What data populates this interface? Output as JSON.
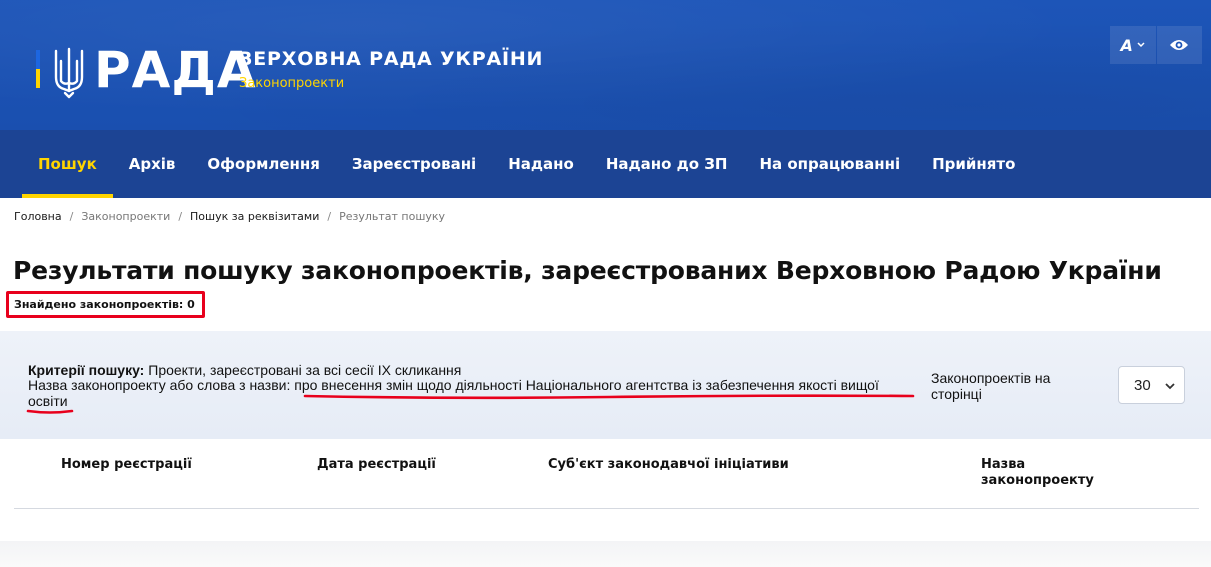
{
  "header": {
    "logo_word": "РАДА",
    "org_title": "ВЕРХОВНА РАДА УКРАЇНИ",
    "org_subtitle": "Законопроекти",
    "font_size_button": "A",
    "colors": {
      "header_bg": "#1d55b8",
      "nav_bg": "#1c4494",
      "accent": "#ffd500",
      "flag_blue": "#1d66e0",
      "flag_yellow": "#ffd500"
    }
  },
  "nav": {
    "items": [
      {
        "label": "Пошук",
        "active": true
      },
      {
        "label": "Архів"
      },
      {
        "label": "Оформлення"
      },
      {
        "label": "Зареєстровані"
      },
      {
        "label": "Надано"
      },
      {
        "label": "Надано до ЗП"
      },
      {
        "label": "На опрацюванні"
      },
      {
        "label": "Прийнято"
      }
    ]
  },
  "breadcrumb": {
    "items": [
      "Головна",
      "Законопроекти",
      "Пошук за реквізитами",
      "Результат пошуку"
    ]
  },
  "main": {
    "title": "Результати пошуку законопроектів, зареєстрованих Верховною Радою України",
    "found_label": "Знайдено законопроектів: 0"
  },
  "criteria": {
    "label": "Критерії пошуку:",
    "value": "Проекти, зареєстровані за всі сесії IX скликання",
    "name_label": "Назва законопроекту або слова з назви:",
    "name_value": "про внесення змін щодо діяльності Національного агентства із забезпечення якості вищої освіти",
    "per_page_label": "Законопроектів на сторінці",
    "per_page_value": "30"
  },
  "table": {
    "columns": [
      "Номер реєстрації",
      "Дата реєстрації",
      "Суб'єкт законодавчої ініціативи",
      "Назва законопроекту"
    ]
  },
  "annotation_color": "#e8001c"
}
